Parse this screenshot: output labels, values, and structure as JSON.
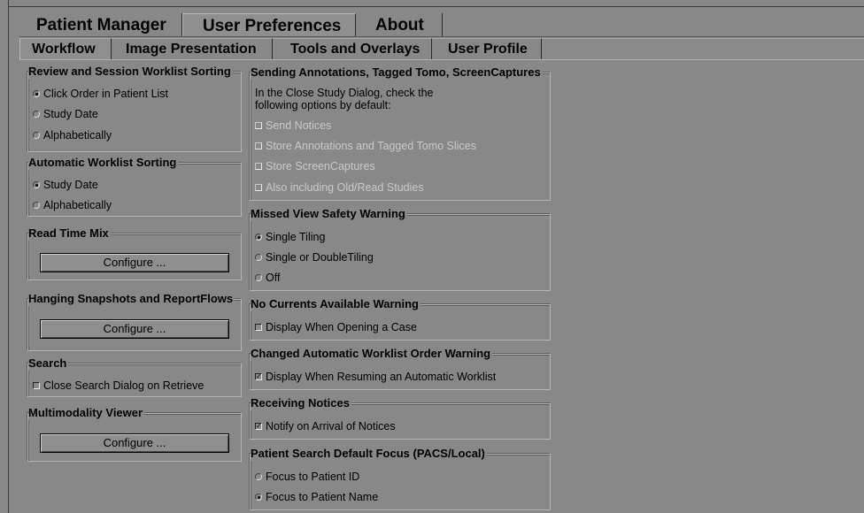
{
  "tabs_main": [
    "Patient Manager",
    "User Preferences",
    "About"
  ],
  "tabs_sub": [
    "Workflow",
    "Image Presentation",
    "Tools and Overlays",
    "User Profile"
  ],
  "review_sorting": {
    "title": "Review and Session Worklist Sorting",
    "options": [
      "Click Order in Patient List",
      "Study Date",
      "Alphabetically"
    ],
    "selected": 0
  },
  "auto_sorting": {
    "title": "Automatic Worklist Sorting",
    "options": [
      "Study Date",
      "Alphabetically"
    ],
    "selected": 0
  },
  "read_time_mix": {
    "title": "Read Time Mix",
    "button": "Configure ..."
  },
  "hanging_snapshots": {
    "title": "Hanging Snapshots and ReportFlows",
    "button": "Configure ..."
  },
  "search": {
    "title": "Search",
    "checkbox": "Close Search Dialog on Retrieve",
    "checked": false
  },
  "multimodality": {
    "title": "Multimodality Viewer",
    "button": "Configure ..."
  },
  "sending_annotations": {
    "title": "Sending Annotations, Tagged Tomo, ScreenCaptures",
    "desc_line1": "In the Close Study Dialog, check the",
    "desc_line2": "following options by default:",
    "options": [
      "Send Notices",
      "Store Annotations and Tagged Tomo Slices",
      "Store ScreenCaptures",
      "Also including Old/Read Studies"
    ]
  },
  "missed_view": {
    "title": "Missed View Safety Warning",
    "options": [
      "Single Tiling",
      "Single or DoubleTiling",
      "Off"
    ],
    "selected": 0
  },
  "no_currents": {
    "title": "No Currents Available Warning",
    "checkbox": "Display When Opening a Case",
    "checked": false
  },
  "changed_order": {
    "title": "Changed Automatic Worklist Order Warning",
    "checkbox": "Display When Resuming an Automatic Worklist",
    "checked": true
  },
  "receiving_notices": {
    "title": "Receiving Notices",
    "checkbox": "Notify on Arrival of Notices",
    "checked": true
  },
  "patient_search": {
    "title": "Patient Search Default Focus (PACS/Local)",
    "options": [
      "Focus to Patient ID",
      "Focus to Patient Name"
    ],
    "selected": 1
  },
  "colors": {
    "background": "#888888",
    "border_dark": "#3a3a3a",
    "border_light": "#b4b4b4",
    "disabled_text": "#c8c8c8"
  }
}
